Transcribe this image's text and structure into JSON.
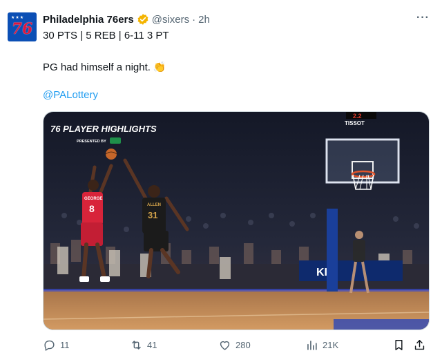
{
  "tweet": {
    "author_name": "Philadelphia 76ers",
    "handle": "@sixers",
    "separator": "·",
    "time": "2h",
    "more_label": "···",
    "avatar_text": "76",
    "stats_line": "30 PTS | 5 REB | 6-11 3 PT",
    "body_text": "PG had himself a night.",
    "body_emoji": "👏",
    "mention": "@PALottery"
  },
  "media": {
    "overlay_title": "76 PLAYER HIGHLIGHTS",
    "overlay_subtitle": "PRESENTED BY",
    "shot_clock_brand": "TISSOT",
    "player_left_name": "GEORGE",
    "player_left_number": "8",
    "player_right_name": "ALLEN",
    "player_right_number": "31",
    "colors": {
      "court": "#c98d55",
      "crowd": "#1d2030",
      "sixers_red": "#d8243a",
      "cavs_black": "#1b1b1b"
    }
  },
  "actions": {
    "replies": "11",
    "retweets": "41",
    "likes": "280",
    "views": "21K"
  },
  "colors": {
    "link": "#1d9bf0",
    "muted": "#536471",
    "verified": "#f4b400"
  }
}
